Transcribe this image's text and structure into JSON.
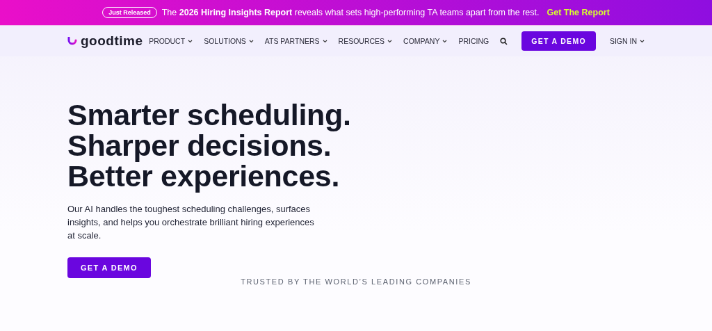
{
  "announcement": {
    "badge": "Just Released",
    "text": "The **2026 Hiring Insights Report** reveals what sets high-performing TA teams apart from the rest.",
    "link": "Get The Report"
  },
  "header": {
    "logo": "goodtime",
    "nav": [
      {
        "label": "PRODUCT",
        "has_menu": true
      },
      {
        "label": "SOLUTIONS",
        "has_menu": true
      },
      {
        "label": "ATS PARTNERS",
        "has_menu": true
      },
      {
        "label": "RESOURCES",
        "has_menu": true
      },
      {
        "label": "COMPANY",
        "has_menu": true
      },
      {
        "label": "PRICING",
        "has_menu": false
      }
    ],
    "cta": "GET A DEMO",
    "sign_in": {
      "label": "SIGN IN",
      "has_menu": true
    }
  },
  "hero": {
    "headline": [
      "Smarter scheduling.",
      "Sharper decisions.",
      "Better experiences."
    ],
    "body": "Our AI handles the toughest scheduling challenges, surfaces insights, and helps you orchestrate brilliant hiring experiences at scale.",
    "cta": "GET A DEMO"
  },
  "trusted": "TRUSTED BY THE WORLD’S LEADING COMPANIES"
}
